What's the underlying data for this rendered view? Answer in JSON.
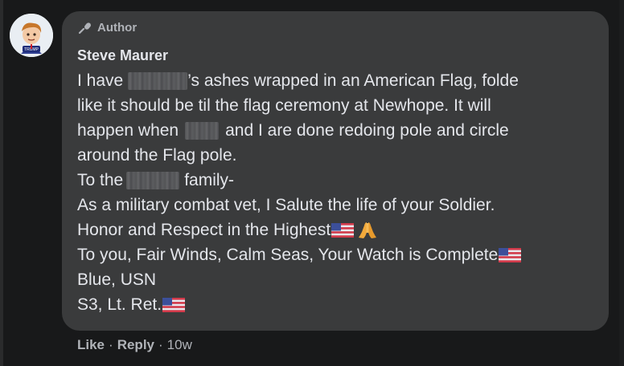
{
  "comment": {
    "badge_label": "Author",
    "author_name": "Steve Maurer",
    "lines": {
      "l1_pre": "I have",
      "l1_post": "’s ashes wrapped in an American Flag, folde",
      "l2": "like it should be til the flag ceremony at Newhope. It will",
      "l3_pre": "happen when",
      "l3_post": "and I are done redoing pole and circle",
      "l4": "around the Flag pole.",
      "l5_pre": "To the",
      "l5_post": "family-",
      "l6": "As a military combat vet, I Salute the life of your Soldier.",
      "l7": "Honor and Respect in the Highest",
      "l8": "To you, Fair Winds, Calm Seas, Your Watch is Complete",
      "l9": "Blue, USN",
      "l10": "S3, Lt. Ret."
    },
    "avatar_icon": "profile-cartoon-avatar",
    "badge_icon": "microphone-icon"
  },
  "actions": {
    "like": "Like",
    "reply": "Reply",
    "separator": "·",
    "time": "10w"
  },
  "colors": {
    "background": "#18191a",
    "bubble": "#3a3b3c",
    "text": "#e4e6eb",
    "muted": "#b0b3b8"
  }
}
